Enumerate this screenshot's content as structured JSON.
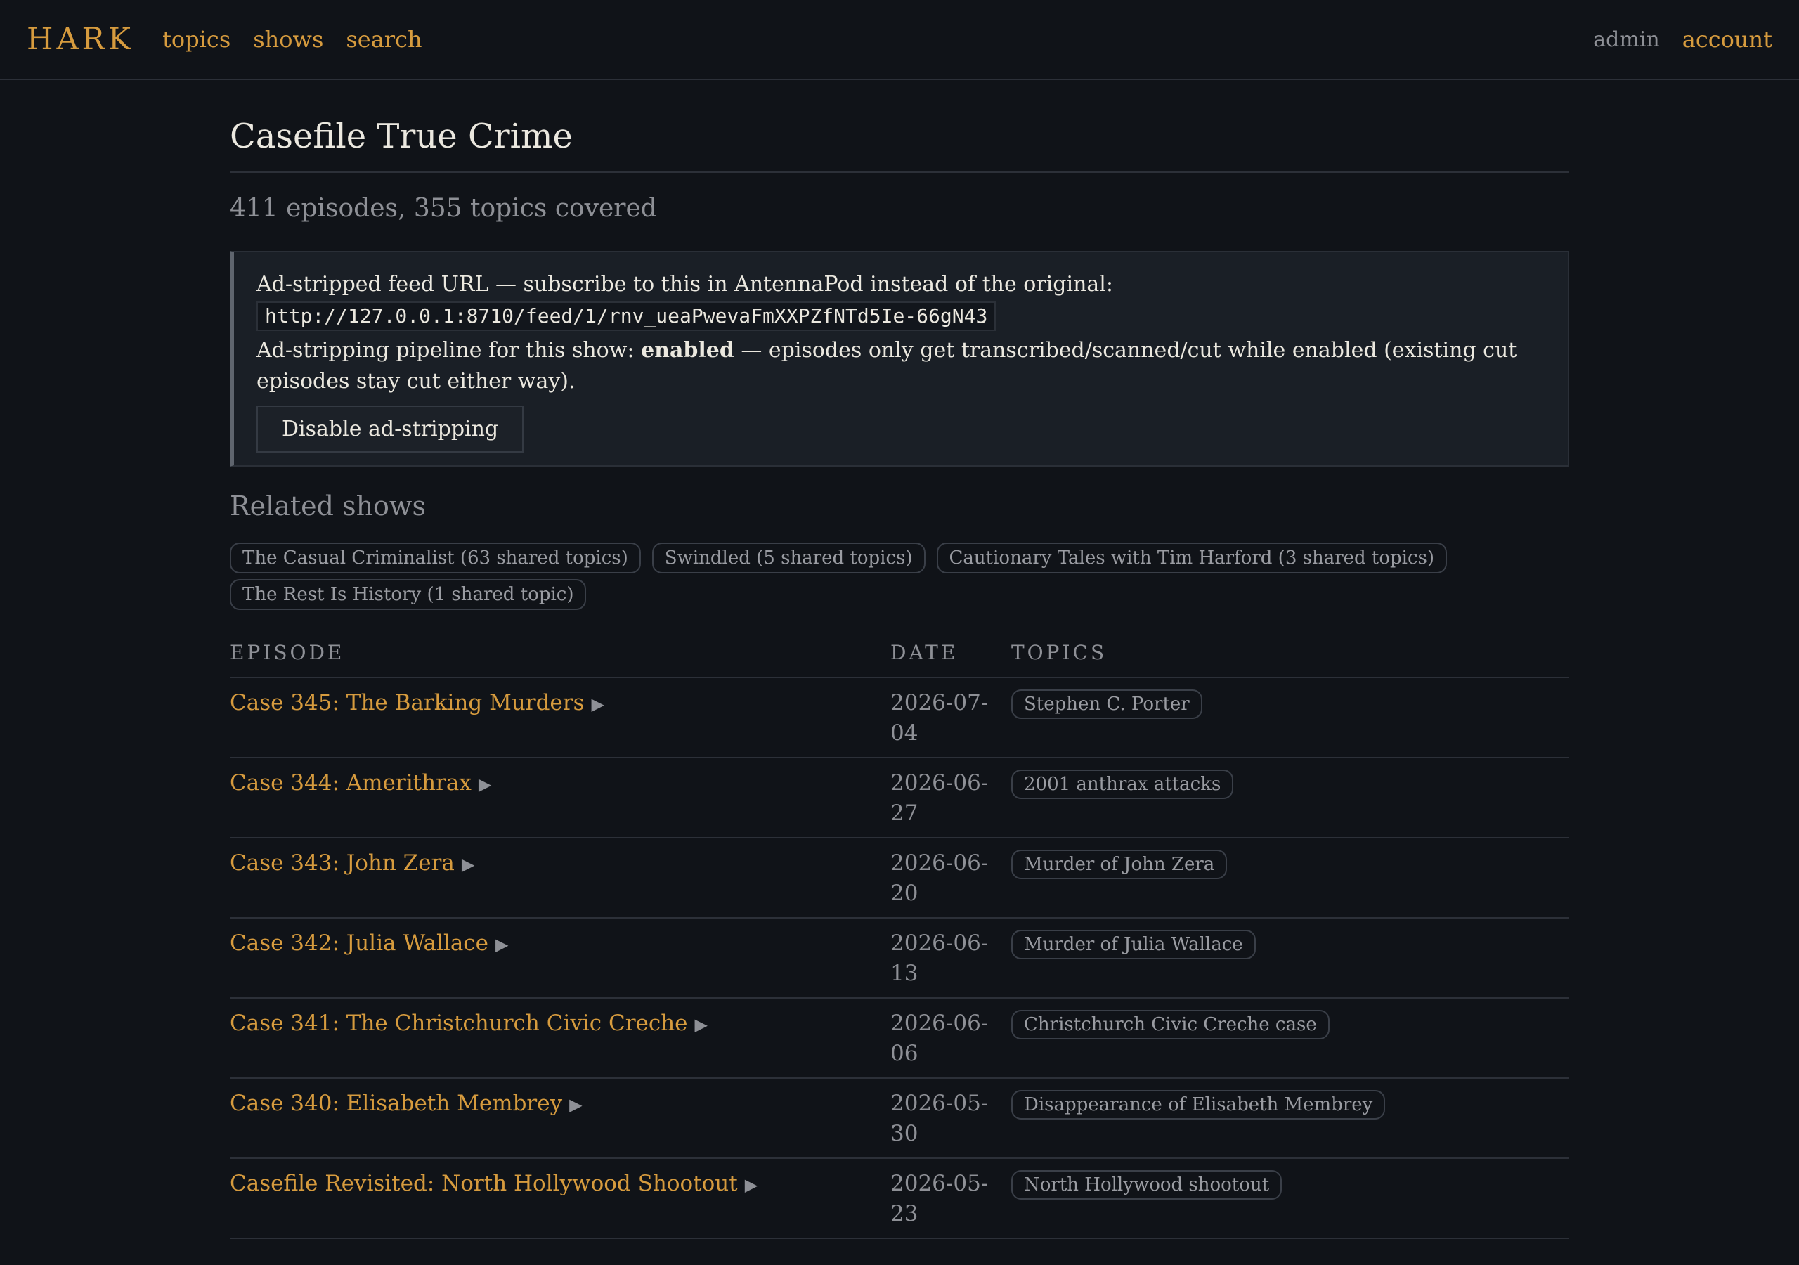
{
  "nav": {
    "brand": "HARK",
    "links": [
      "topics",
      "shows",
      "search"
    ],
    "admin": "admin",
    "account": "account"
  },
  "show": {
    "title": "Casefile True Crime",
    "stats": "411 episodes, 355 topics covered"
  },
  "feed": {
    "label": "Ad-stripped feed URL — subscribe to this in AntennaPod instead of the original:",
    "url": "http://127.0.0.1:8710/feed/1/rnv_ueaPwevaFmXXPZfNTd5Ie-66gN43",
    "pipeline_prefix": "Ad-stripping pipeline for this show: ",
    "pipeline_status": "enabled",
    "pipeline_suffix": " — episodes only get transcribed/scanned/cut while enabled (existing cut episodes stay cut either way).",
    "disable_button": "Disable ad-stripping"
  },
  "related": {
    "heading": "Related shows",
    "shows": [
      "The Casual Criminalist (63 shared topics)",
      "Swindled (5 shared topics)",
      "Cautionary Tales with Tim Harford (3 shared topics)",
      "The Rest Is History (1 shared topic)"
    ]
  },
  "table": {
    "headers": {
      "episode": "EPISODE",
      "date": "DATE",
      "topics": "TOPICS"
    },
    "play_glyph": "▶",
    "rows": [
      {
        "title": "Case 345: The Barking Murders",
        "date": "2026-07-04",
        "topic": "Stephen C. Porter"
      },
      {
        "title": "Case 344: Amerithrax",
        "date": "2026-06-27",
        "topic": "2001 anthrax attacks"
      },
      {
        "title": "Case 343: John Zera",
        "date": "2026-06-20",
        "topic": "Murder of John Zera"
      },
      {
        "title": "Case 342: Julia Wallace",
        "date": "2026-06-13",
        "topic": "Murder of Julia Wallace"
      },
      {
        "title": "Case 341: The Christchurch Civic Creche",
        "date": "2026-06-06",
        "topic": "Christchurch Civic Creche case"
      },
      {
        "title": "Case 340: Elisabeth Membrey",
        "date": "2026-05-30",
        "topic": "Disappearance of Elisabeth Membrey"
      },
      {
        "title": "Casefile Revisited: North Hollywood Shootout",
        "date": "2026-05-23",
        "topic": "North Hollywood shootout"
      }
    ]
  },
  "colors": {
    "background": "#101318",
    "accent": "#d69b3e",
    "muted": "#8e9096",
    "panel": "#1a1f26"
  }
}
